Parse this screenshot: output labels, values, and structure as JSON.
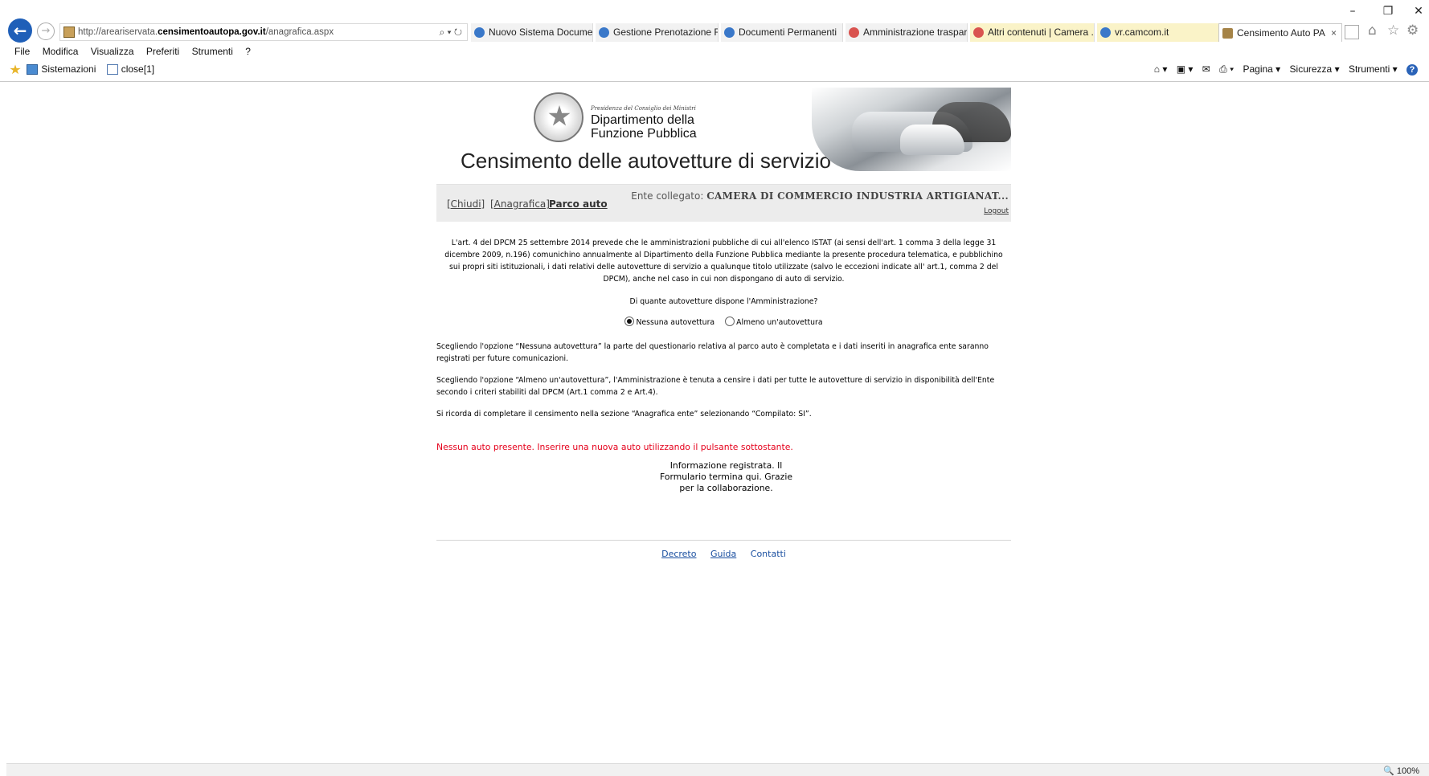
{
  "browser": {
    "address": {
      "prefix": "http://areariservata.",
      "domain": "censimentoautopa.gov.it",
      "path": "/anagrafica.aspx",
      "tools": "⌕ ▾ ↻"
    },
    "tabs": [
      {
        "label": "Nuovo Sistema Docume...",
        "icon": "ie-icon"
      },
      {
        "label": "Gestione Prenotazione R...",
        "icon": "ie-icon"
      },
      {
        "label": "Documenti Permanenti",
        "icon": "ie-icon"
      },
      {
        "label": "Amministrazione traspar...",
        "icon": "site-icon"
      },
      {
        "label": "Altri contenuti | Camera ...",
        "icon": "site-icon"
      },
      {
        "label": "vr.camcom.it",
        "icon": "ie-icon"
      },
      {
        "label": "Censimento Auto PA",
        "icon": "page-icon",
        "active": true
      }
    ],
    "window_controls": [
      "–",
      "❐",
      "✕"
    ],
    "menu": [
      "File",
      "Modifica",
      "Visualizza",
      "Preferiti",
      "Strumenti",
      "?"
    ],
    "favorites": [
      "Sistemazioni",
      "close[1]"
    ],
    "commands": [
      "Pagina ▾",
      "Sicurezza ▾",
      "Strumenti ▾"
    ],
    "zoom": "🔍 100%"
  },
  "header": {
    "presidenza": "Presidenza del Consiglio dei Ministri",
    "dept_line1": "Dipartimento della",
    "dept_line2": "Funzione Pubblica",
    "title": "Censimento delle autovetture di servizio"
  },
  "nav": {
    "chiudi": "[Chiudi]",
    "anagrafica": "[Anagrafica]",
    "parco_auto": "Parco auto",
    "ente_label": "Ente collegato:",
    "ente_name": "CAMERA DI COMMERCIO INDUSTRIA ARTIGIANAT...",
    "logout": "Logout"
  },
  "main": {
    "intro": "L'art. 4 del DPCM 25 settembre 2014 prevede che le amministrazioni pubbliche di cui all'elenco ISTAT (ai sensi dell'art. 1 comma 3 della legge 31 dicembre 2009, n.196) comunichino annualmente al Dipartimento della Funzione Pubblica mediante la presente procedura telematica, e pubblichino sui propri siti istituzionali, i dati relativi delle autovetture di servizio a qualunque titolo utilizzate (salvo le eccezioni indicate all' art.1, comma 2 del DPCM), anche nel caso in cui non dispongano di auto di servizio.",
    "question": "Di quante autovetture dispone l'Amministrazione?",
    "option_none": "Nessuna autovettura",
    "option_some": "Almeno un'autovettura",
    "selected": "Nessuna autovettura",
    "p_none": "Scegliendo l'opzione “Nessuna autovettura” la parte del questionario relativa al parco auto è completata e i dati inseriti in anagrafica ente saranno registrati per future comunicazioni.",
    "p_some": "Scegliendo l'opzione “Almeno un'autovettura”, l'Amministrazione è tenuta a censire i dati per tutte le autovetture di servizio in disponibilità dell'Ente secondo i criteri stabiliti dal DPCM (Art.1 comma 2 e Art.4).",
    "p_reminder": "Si ricorda di completare il censimento nella sezione “Anagrafica ente” selezionando “Compilato: SI”.",
    "error": "Nessun auto presente. Inserire una nuova auto utilizzando il pulsante sottostante.",
    "done": "Informazione registrata. Il Formulario termina qui. Grazie per la collaborazione."
  },
  "footer": {
    "decreto": "Decreto",
    "guida": "Guida",
    "contatti": "Contatti"
  },
  "colors": {
    "error": "#e5001b",
    "link": "#1a4fa0",
    "nav_bg": "#ececec"
  }
}
